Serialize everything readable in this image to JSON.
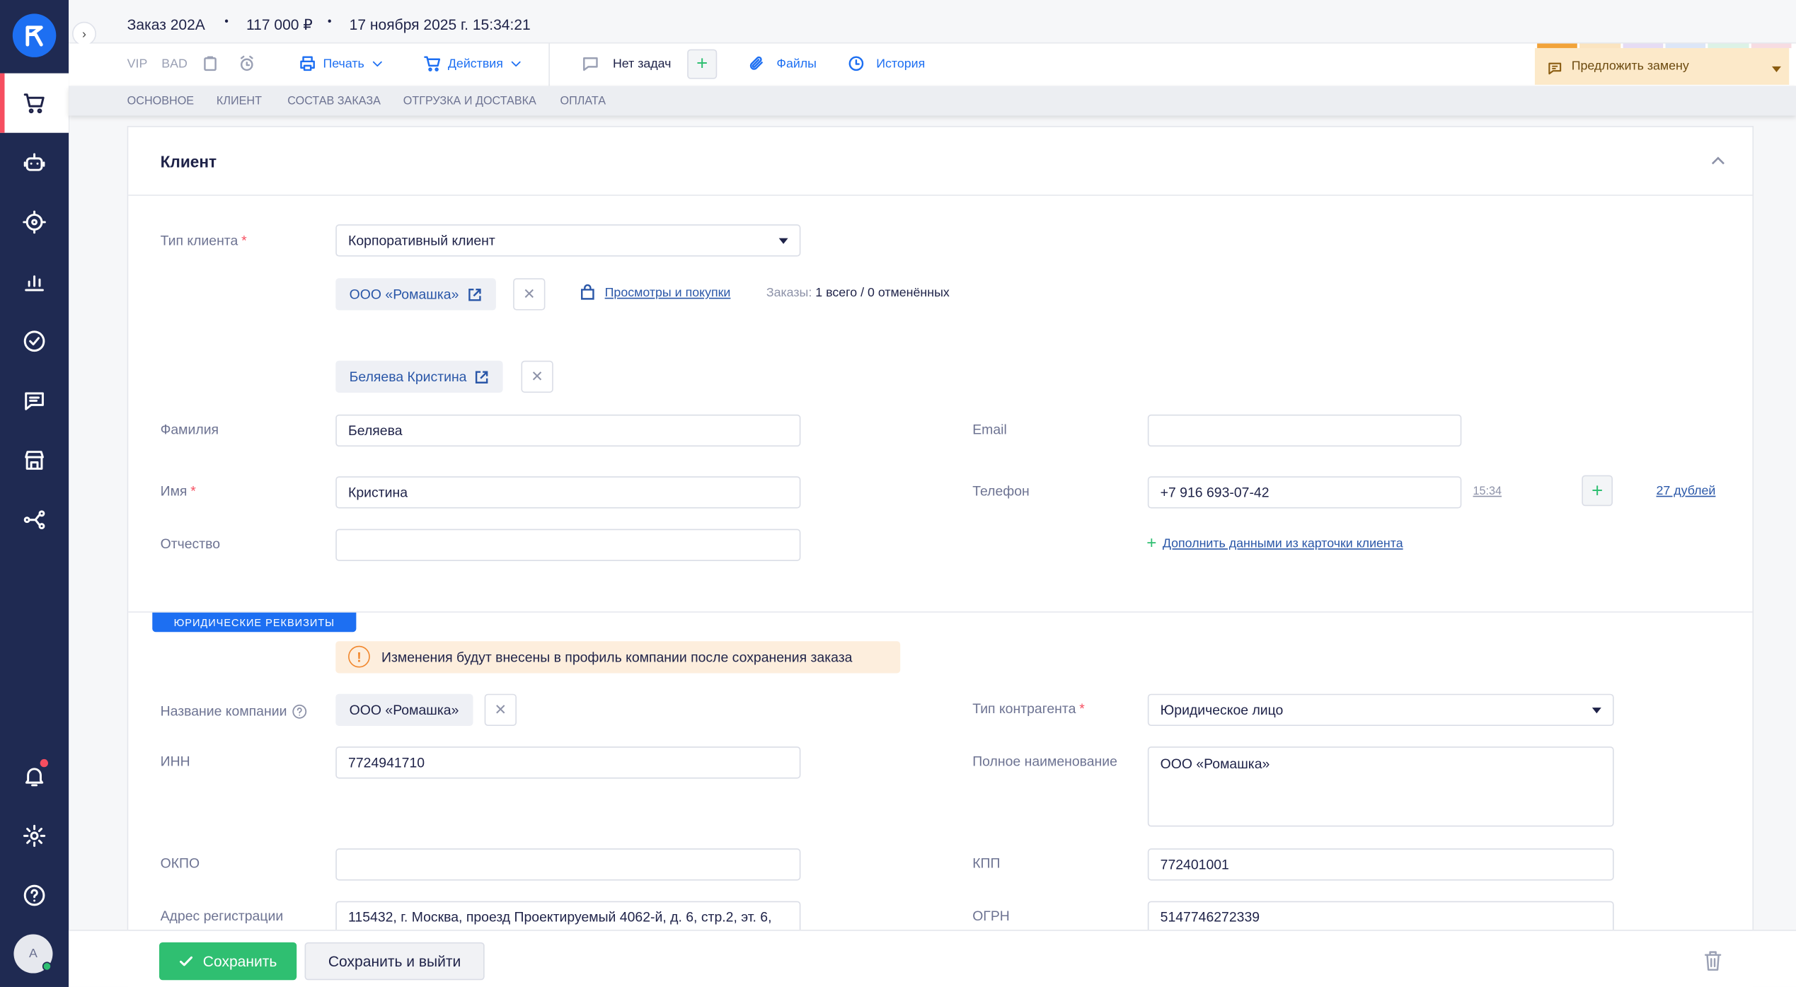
{
  "order": {
    "title": "Заказ 202A",
    "sep": "•",
    "total": "117 000 ₽",
    "date": "17 ноября 2025 г. 15:34:21"
  },
  "toolbar": {
    "vip": "VIP",
    "bad": "BAD",
    "print": "Печать",
    "actions": "Действия",
    "tasks": "Нет задач",
    "files": "Файлы",
    "history": "История",
    "suggest": "Предложить замену"
  },
  "tabs": [
    "Основное",
    "Клиент",
    "Состав заказа",
    "Отгрузка и доставка",
    "Оплата"
  ],
  "client": {
    "section_title": "Клиент",
    "type_label": "Тип клиента",
    "type_value": "Корпоративный клиент",
    "company_chip": "ООО «Ромашка»",
    "views_link": "Просмотры и покупки",
    "orders_label": "Заказы:",
    "orders_value": "1 всего / 0 отменённых",
    "contact_chip": "Беляева Кристина",
    "lastname_label": "Фамилия",
    "lastname_value": "Беляева",
    "firstname_label": "Имя",
    "firstname_value": "Кристина",
    "patronymic_label": "Отчество",
    "patronymic_value": "",
    "email_label": "Email",
    "email_value": "",
    "phone_label": "Телефон",
    "phone_value": "+7 916 693-07-42",
    "phone_time": "15:34",
    "duplicates": "27 дублей",
    "fill_link": "Дополнить данными из карточки клиента"
  },
  "legal": {
    "badge": "Юридические реквизиты",
    "warning": "Изменения будут внесены в профиль компании после сохранения заказа",
    "company_label": "Название компании",
    "company_value": "ООО «Ромашка»",
    "inn_label": "ИНН",
    "inn_value": "7724941710",
    "okpo_label": "ОКПО",
    "okpo_value": "",
    "address_label": "Адрес регистрации",
    "address_value": "115432, г. Москва, проезд Проектируемый 4062-й, д. 6, стр.2, эт. 6,",
    "contragent_label": "Тип контрагента",
    "contragent_value": "Юридическое лицо",
    "fullname_label": "Полное наименование",
    "fullname_value": "ООО «Ромашка»",
    "kpp_label": "КПП",
    "kpp_value": "772401001",
    "ogrn_label": "ОГРН",
    "ogrn_value": "5147746272339"
  },
  "footer": {
    "save": "Сохранить",
    "save_exit": "Сохранить и выйти"
  },
  "user": {
    "avatar_letter": "А"
  },
  "colors": {
    "sidebar": "#1f2a52",
    "accent": "#1d6ff2",
    "save": "#2fbf71",
    "required": "#f64e60",
    "warning_bg": "#fdeedd",
    "suggest_bg": "#fce9c9"
  },
  "sidebar_icons": [
    "cart-icon",
    "bot-icon",
    "target-icon",
    "chart-icon",
    "check-circle-icon",
    "chat-icon",
    "store-icon",
    "share-icon",
    "bell-icon",
    "gear-icon",
    "help-icon"
  ]
}
